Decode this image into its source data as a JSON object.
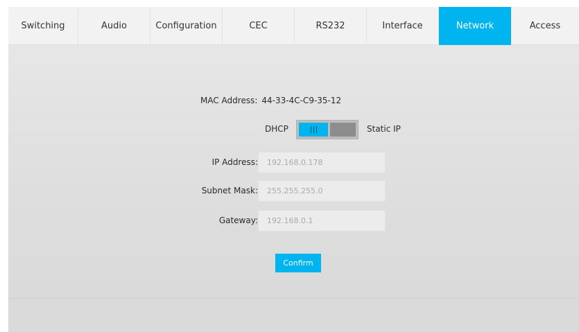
{
  "tabs": [
    {
      "label": "Switching",
      "active": false
    },
    {
      "label": "Audio",
      "active": false
    },
    {
      "label": "Configuration",
      "active": false
    },
    {
      "label": "CEC",
      "active": false
    },
    {
      "label": "RS232",
      "active": false
    },
    {
      "label": "Interface",
      "active": false
    },
    {
      "label": "Network",
      "active": true
    },
    {
      "label": "Access",
      "active": false
    }
  ],
  "network": {
    "mac_label": "MAC Address:",
    "mac_value": "44-33-4C-C9-35-12",
    "mode_left": "DHCP",
    "mode_right": "Static IP",
    "mode_selected": "DHCP",
    "fields": [
      {
        "label": "IP Address:",
        "value": "192.168.0.178"
      },
      {
        "label": "Subnet Mask:",
        "value": "255.255.255.0"
      },
      {
        "label": "Gateway:",
        "value": "192.168.0.1"
      }
    ],
    "confirm_label": "Confirm"
  },
  "colors": {
    "accent": "#00b4ef",
    "toggle_off": "#8d8d8d",
    "input_text": "#a9a9a9"
  },
  "icons": {
    "toggle_grip": "grip-lines-icon"
  }
}
